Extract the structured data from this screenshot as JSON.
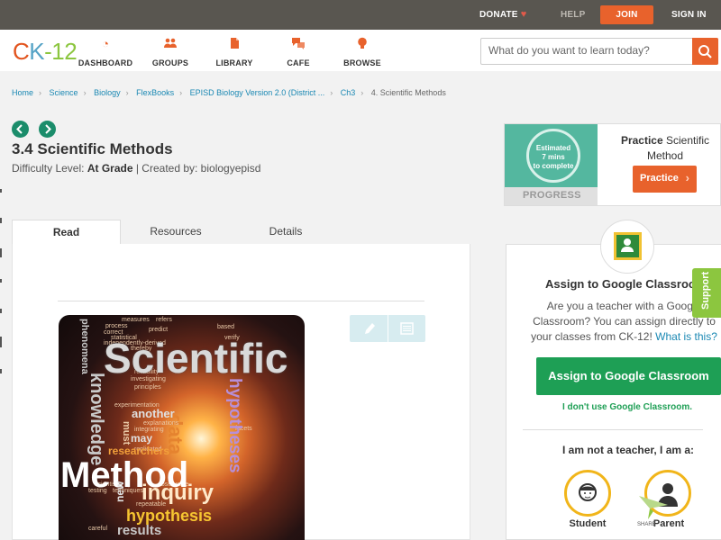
{
  "topbar": {
    "donate": "DONATE",
    "help": "HELP",
    "join": "JOIN",
    "signin": "SIGN IN"
  },
  "header": {
    "logo_parts": [
      "C",
      "K",
      "-12"
    ],
    "nav": [
      "DASHBOARD",
      "GROUPS",
      "LIBRARY",
      "CAFE",
      "BROWSE"
    ],
    "search_placeholder": "What do you want to learn today?"
  },
  "breadcrumb": [
    "Home",
    "Science",
    "Biology",
    "FlexBooks",
    "EPISD Biology Version 2.0 (District ...",
    "Ch3",
    "4. Scientific Methods"
  ],
  "page": {
    "title": "3.4 Scientific Methods",
    "difficulty_prefix": "Difficulty Level:",
    "difficulty": "At Grade",
    "created_by": "| Created by: biologyepisd"
  },
  "tabs": [
    "Read",
    "Resources",
    "Details"
  ],
  "word_cloud": {
    "big": [
      "Scientific",
      "Method",
      "inquiry",
      "hypothesis",
      "results",
      "hypotheses",
      "knowledge",
      "data",
      "phenomena"
    ],
    "medium": [
      "researchers",
      "another",
      "may",
      "must",
      "new",
      "explanations",
      "experimentation",
      "investigating"
    ],
    "small": [
      "measures",
      "refers",
      "process",
      "correct",
      "predict",
      "statistical",
      "independently-derived",
      "thereby",
      "principles",
      "verify",
      "based",
      "facets",
      "scientists",
      "observable",
      "repeatable",
      "testing",
      "techniques",
      "careful",
      "integrating",
      "replicated",
      "reliability"
    ]
  },
  "practice": {
    "estimated": "Estimated",
    "mins": "7 mins",
    "complete": "to complete",
    "progress_label": "PROGRESS",
    "title_bold": "Practice",
    "title_rest": "Scientific Method",
    "button": "Practice"
  },
  "assign": {
    "title": "Assign to Google Classroom",
    "text": "Are you a teacher with a Google Classroom? You can assign directly to your classes from CK-12!",
    "link": "What is this?",
    "button": "Assign to Google Classroom",
    "no_classroom": "I don't use Google Classroom.",
    "role_prompt": "I am not a teacher, I am a:",
    "roles": [
      "Student",
      "Parent"
    ],
    "share": "SHARE"
  },
  "support": "Support"
}
